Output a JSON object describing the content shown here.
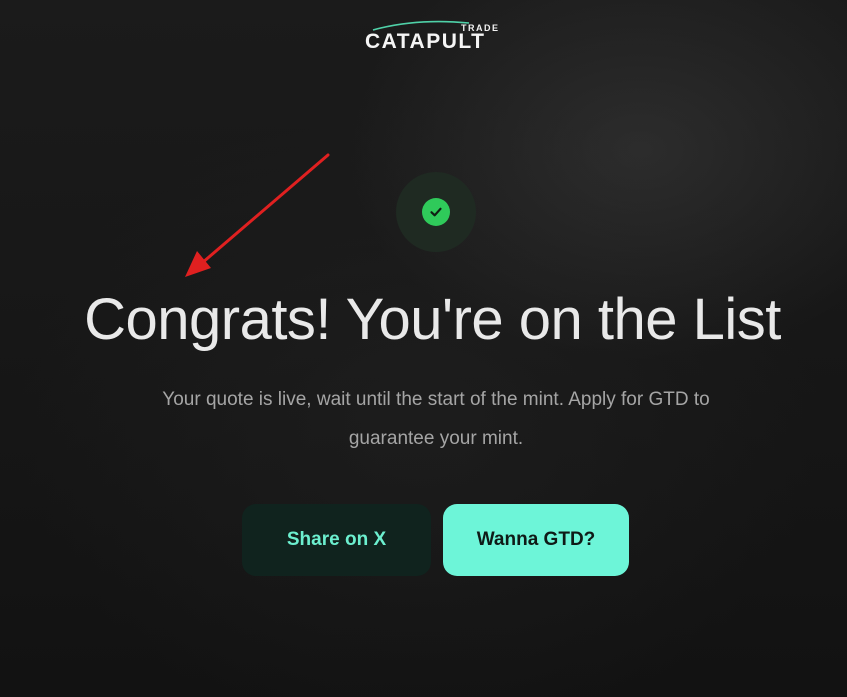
{
  "brand": {
    "trade": "TRADE",
    "name": "CATAPULT"
  },
  "hero": {
    "title": "Congrats! You're on the List",
    "subtitle": "Your quote is live, wait until the start of the mint. Apply for GTD to guarantee your mint."
  },
  "actions": {
    "share_label": "Share on X",
    "gtd_label": "Wanna GTD?"
  },
  "colors": {
    "accent": "#6df5d8",
    "success": "#2fca5a",
    "annotation_arrow": "#e02020",
    "background": "#141414"
  },
  "icons": {
    "status": "check-circle-icon",
    "annotation": "red-arrow-icon"
  }
}
